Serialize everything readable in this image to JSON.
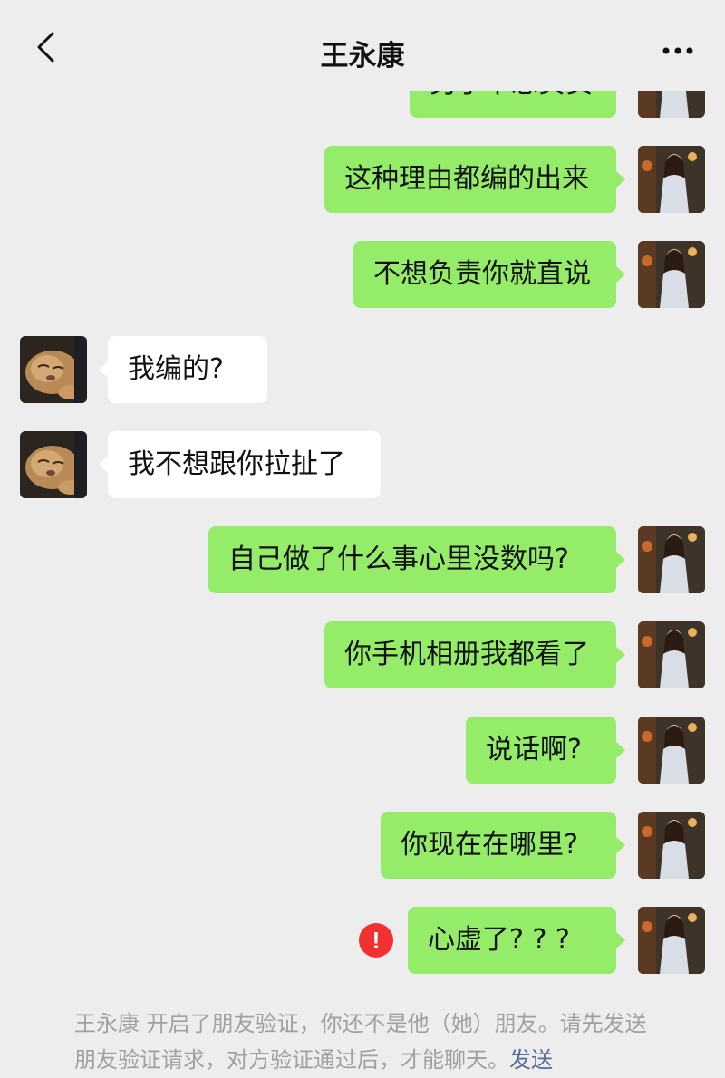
{
  "header": {
    "title": "王永康",
    "back_icon": "chevron-left-icon",
    "more_icon": "more-dots-icon"
  },
  "messages": [
    {
      "side": "me",
      "text": "另了不想负责",
      "partial": true
    },
    {
      "side": "me",
      "text": "这种理由都编的出来"
    },
    {
      "side": "me",
      "text": "不想负责你就直说"
    },
    {
      "side": "peer",
      "text": "我编的?"
    },
    {
      "side": "peer",
      "text": "我不想跟你拉扯了"
    },
    {
      "side": "me",
      "text": "自己做了什么事心里没数吗?"
    },
    {
      "side": "me",
      "text": "你手机相册我都看了"
    },
    {
      "side": "me",
      "text": "说话啊?"
    },
    {
      "side": "me",
      "text": "你现在在哪里?"
    },
    {
      "side": "me",
      "text": "心虚了? ? ?",
      "failed": true
    }
  ],
  "system_note": {
    "text": "王永康 开启了朋友验证，你还不是他（她）朋友。请先发送朋友验证请求，对方验证通过后，才能聊天。",
    "link": "发送"
  },
  "colors": {
    "background": "#ededed",
    "my_bubble": "#95ec69",
    "peer_bubble": "#ffffff",
    "error": "#f23030"
  }
}
